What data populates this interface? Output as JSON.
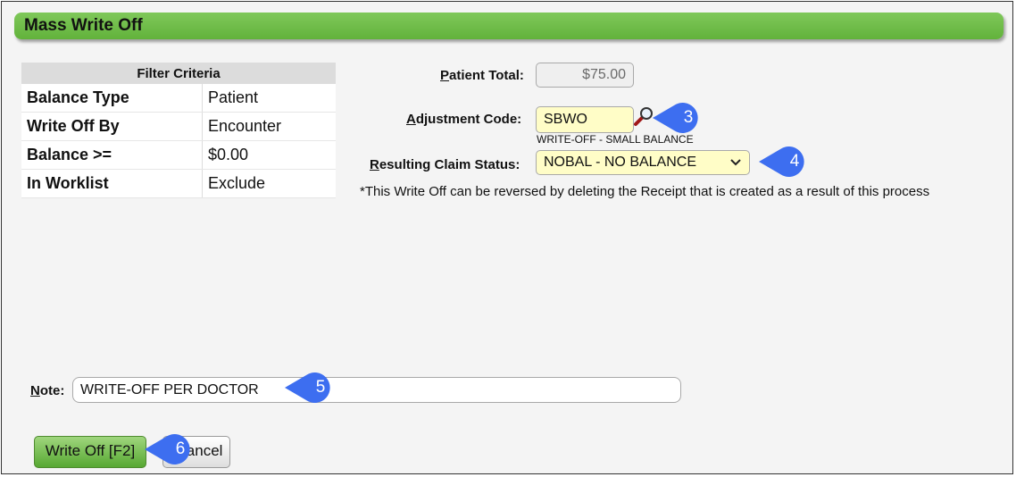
{
  "window": {
    "title": "Mass Write Off"
  },
  "filter": {
    "header": "Filter Criteria",
    "rows": [
      {
        "key": "Balance Type",
        "value": "Patient"
      },
      {
        "key": "Write Off By",
        "value": "Encounter"
      },
      {
        "key": "Balance >=",
        "value": "$0.00"
      },
      {
        "key": "In Worklist",
        "value": "Exclude"
      }
    ]
  },
  "form": {
    "patient_total": {
      "label_hot": "P",
      "label_rest": "atient Total:",
      "value": "$75.00"
    },
    "adjustment_code": {
      "label_hot": "A",
      "label_rest": "djustment Code:",
      "value": "SBWO",
      "description": "WRITE-OFF - SMALL BALANCE"
    },
    "resulting_claim_status": {
      "label_hot": "R",
      "label_rest": "esulting Claim Status:",
      "value": "NOBAL - NO BALANCE"
    },
    "notice": "*This Write Off can be reversed by deleting the Receipt that is created as a result of this process",
    "note": {
      "label_hot": "N",
      "label_rest": "ote:",
      "value": "WRITE-OFF PER DOCTOR"
    }
  },
  "buttons": {
    "write_off": "Write Off [F2]",
    "cancel": "Cancel"
  },
  "callouts": [
    "3",
    "4",
    "5",
    "6"
  ],
  "colors": {
    "title_bar": "#6abb43",
    "callout": "#3d6ef0",
    "highlight_field": "#fffdc7",
    "write_off_button": "#7cc257"
  },
  "icons": {
    "lookup": "magnifier-icon",
    "dropdown": "chevron-down-icon"
  }
}
